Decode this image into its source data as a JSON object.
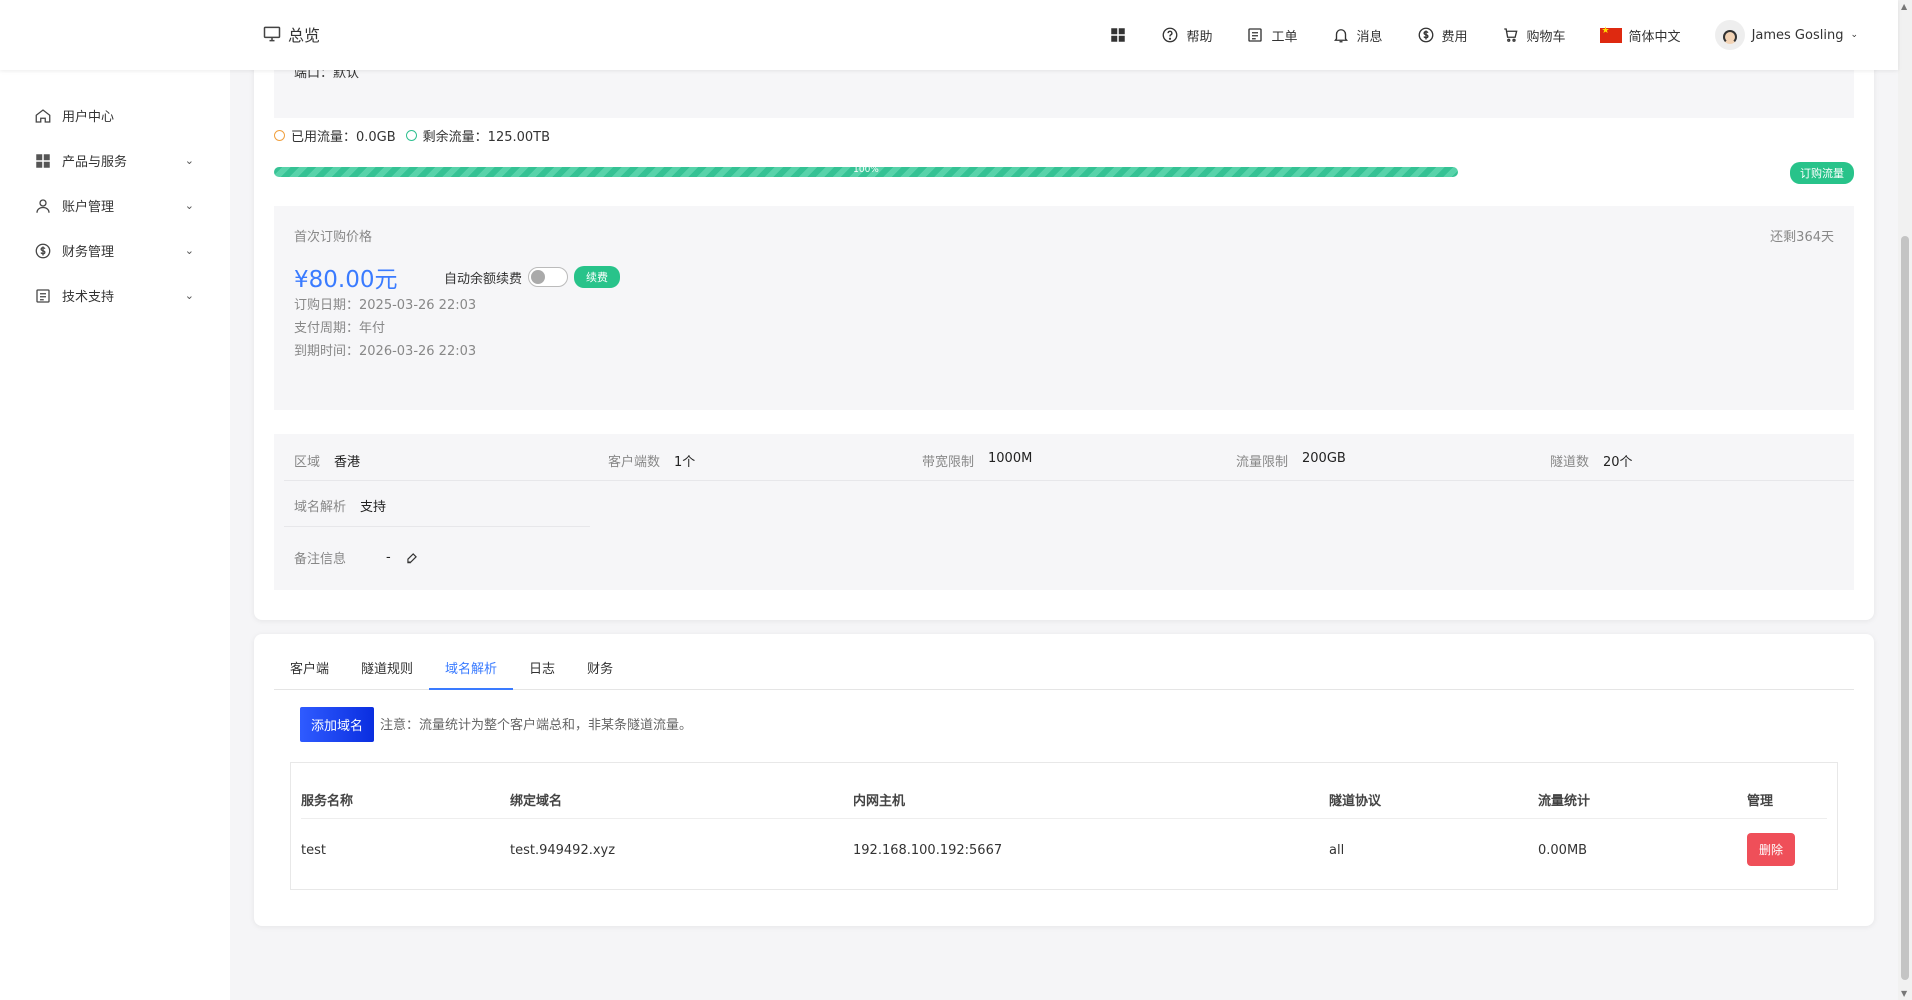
{
  "header": {
    "overview_label": "总览",
    "nav": {
      "help": "帮助",
      "ticket": "工单",
      "message": "消息",
      "fee": "费用",
      "cart": "购物车",
      "language": "简体中文",
      "user": "James Gosling"
    }
  },
  "sidebar": {
    "items": [
      {
        "label": "用户中心"
      },
      {
        "label": "产品与服务"
      },
      {
        "label": "账户管理"
      },
      {
        "label": "财务管理"
      },
      {
        "label": "技术支持"
      }
    ]
  },
  "product": {
    "port_line": "端口：默认",
    "used_traffic": "已用流量：0.0GB",
    "remaining_traffic": "剩余流量：125.00TB",
    "progress_label": "100%",
    "progress_fraction": 1.0,
    "buy_traffic_label": "订购流量",
    "first_price_label": "首次订购价格",
    "days_left": "还剩364天",
    "price": "¥80.00元",
    "auto_renew_label": "自动余额续费",
    "renew_label": "续费",
    "order_date": "订购日期：2025-03-26 22:03",
    "pay_cycle": "支付周期：年付",
    "expire_date": "到期时间：2026-03-26 22:03",
    "specs": {
      "region_k": "区域",
      "region_v": "香港",
      "clients_k": "客户端数",
      "clients_v": "1个",
      "bandwidth_k": "带宽限制",
      "bandwidth_v": "1000M",
      "traffic_k": "流量限制",
      "traffic_v": "200GB",
      "tunnels_k": "隧道数",
      "tunnels_v": "20个",
      "dns_k": "域名解析",
      "dns_v": "支持",
      "remark_k": "备注信息",
      "remark_v": "-"
    }
  },
  "tabs": [
    "客户端",
    "隧道规则",
    "域名解析",
    "日志",
    "财务"
  ],
  "domain_section": {
    "add_label": "添加域名",
    "note": "注意：流量统计为整个客户端总和，非某条隧道流量。",
    "columns": [
      "服务名称",
      "绑定域名",
      "内网主机",
      "隧道协议",
      "流量统计",
      "管理"
    ],
    "rows": [
      {
        "name": "test",
        "domain": "test.949492.xyz",
        "host": "192.168.100.192:5667",
        "protocol": "all",
        "traffic": "0.00MB",
        "action": "删除"
      }
    ]
  },
  "colors": {
    "accent": "#3a7bff",
    "success": "#28c38a",
    "danger": "#ef4f59"
  }
}
